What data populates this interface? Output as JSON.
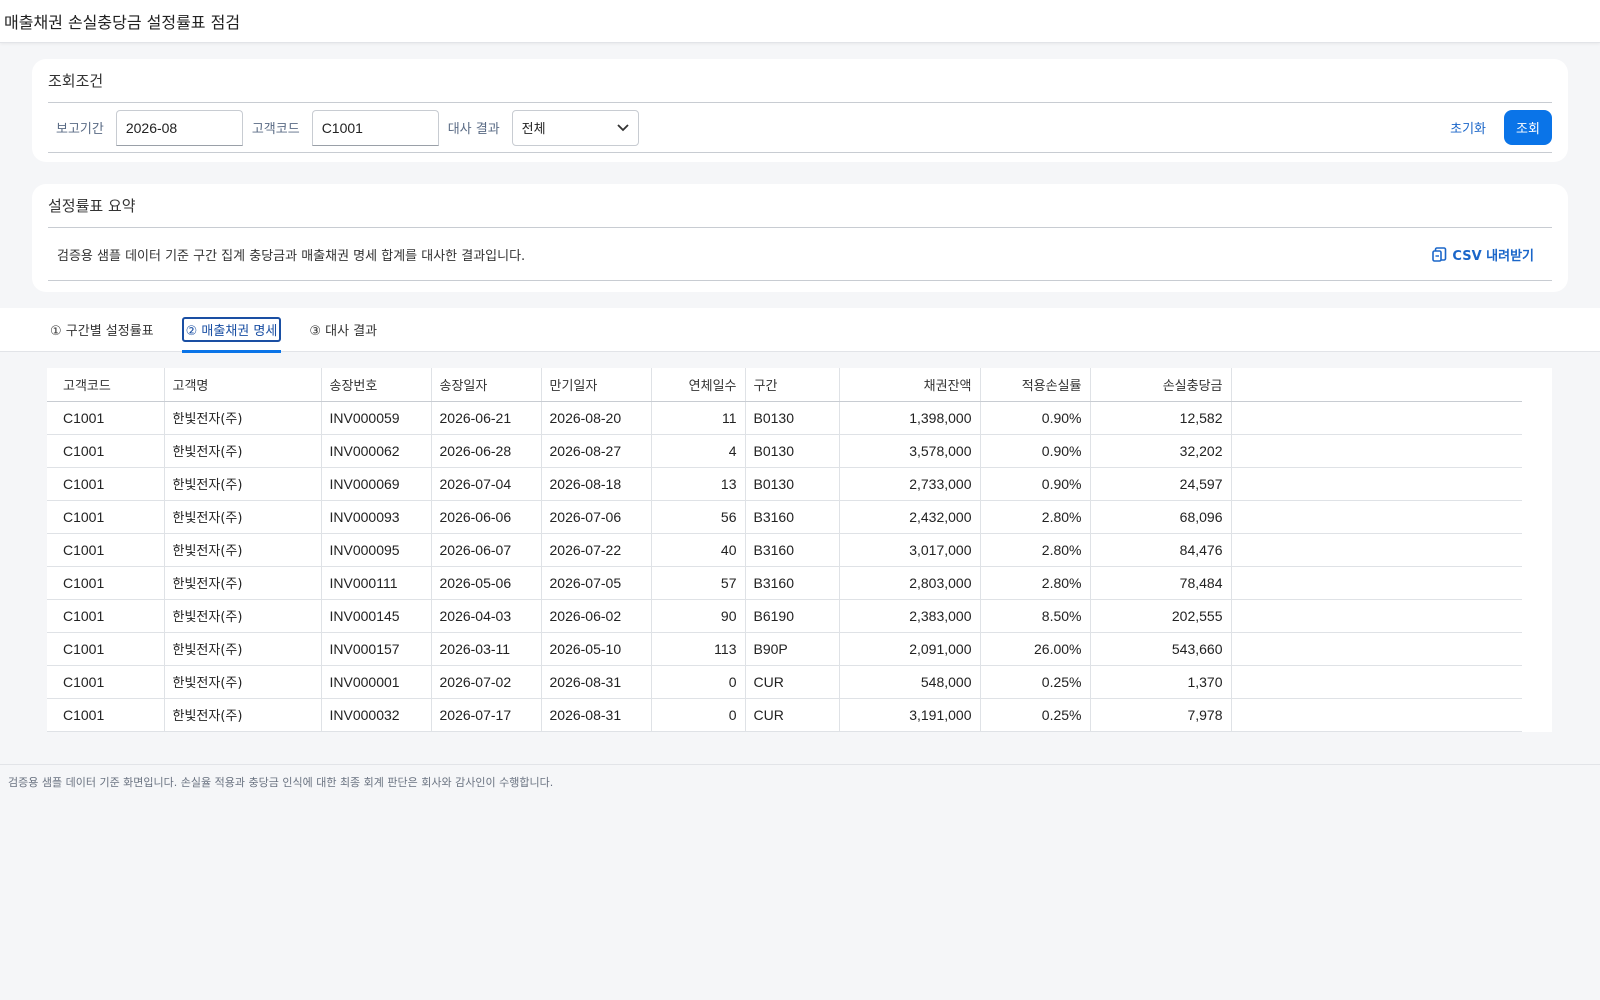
{
  "header": {
    "title": "매출채권 손실충당금 설정률표 점검"
  },
  "filters": {
    "title": "조회조건",
    "period_label": "보고기간",
    "period_value": "2026-08",
    "customer_label": "고객코드",
    "customer_value": "C1001",
    "recon_label": "대사 결과",
    "recon_value": "전체",
    "reset_label": "초기화",
    "search_label": "조회"
  },
  "summary": {
    "title": "설정률표 요약",
    "description": "검증용 샘플 데이터 기준 구간 집계 충당금과 매출채권 명세 합계를 대사한 결과입니다.",
    "csv_label": "CSV 내려받기"
  },
  "tabs": [
    {
      "label": "① 구간별 설정률표"
    },
    {
      "label": "② 매출채권 명세"
    },
    {
      "label": "③ 대사 결과"
    }
  ],
  "table": {
    "headers": [
      "고객코드",
      "고객명",
      "송장번호",
      "송장일자",
      "만기일자",
      "연체일수",
      "구간",
      "채권잔액",
      "적용손실률",
      "손실충당금"
    ],
    "rows": [
      [
        "C1001",
        "한빛전자(주)",
        "INV000059",
        "2026-06-21",
        "2026-08-20",
        "11",
        "B0130",
        "1,398,000",
        "0.90%",
        "12,582"
      ],
      [
        "C1001",
        "한빛전자(주)",
        "INV000062",
        "2026-06-28",
        "2026-08-27",
        "4",
        "B0130",
        "3,578,000",
        "0.90%",
        "32,202"
      ],
      [
        "C1001",
        "한빛전자(주)",
        "INV000069",
        "2026-07-04",
        "2026-08-18",
        "13",
        "B0130",
        "2,733,000",
        "0.90%",
        "24,597"
      ],
      [
        "C1001",
        "한빛전자(주)",
        "INV000093",
        "2026-06-06",
        "2026-07-06",
        "56",
        "B3160",
        "2,432,000",
        "2.80%",
        "68,096"
      ],
      [
        "C1001",
        "한빛전자(주)",
        "INV000095",
        "2026-06-07",
        "2026-07-22",
        "40",
        "B3160",
        "3,017,000",
        "2.80%",
        "84,476"
      ],
      [
        "C1001",
        "한빛전자(주)",
        "INV000111",
        "2026-05-06",
        "2026-07-05",
        "57",
        "B3160",
        "2,803,000",
        "2.80%",
        "78,484"
      ],
      [
        "C1001",
        "한빛전자(주)",
        "INV000145",
        "2026-04-03",
        "2026-06-02",
        "90",
        "B6190",
        "2,383,000",
        "8.50%",
        "202,555"
      ],
      [
        "C1001",
        "한빛전자(주)",
        "INV000157",
        "2026-03-11",
        "2026-05-10",
        "113",
        "B90P",
        "2,091,000",
        "26.00%",
        "543,660"
      ],
      [
        "C1001",
        "한빛전자(주)",
        "INV000001",
        "2026-07-02",
        "2026-08-31",
        "0",
        "CUR",
        "548,000",
        "0.25%",
        "1,370"
      ],
      [
        "C1001",
        "한빛전자(주)",
        "INV000032",
        "2026-07-17",
        "2026-08-31",
        "0",
        "CUR",
        "3,191,000",
        "0.25%",
        "7,978"
      ]
    ]
  },
  "footer": {
    "note": "검증용 샘플 데이터 기준 화면입니다. 손실율 적용과 충당금 인식에 대한 최종 회계 판단은 회사와 감사인이 수행합니다."
  }
}
